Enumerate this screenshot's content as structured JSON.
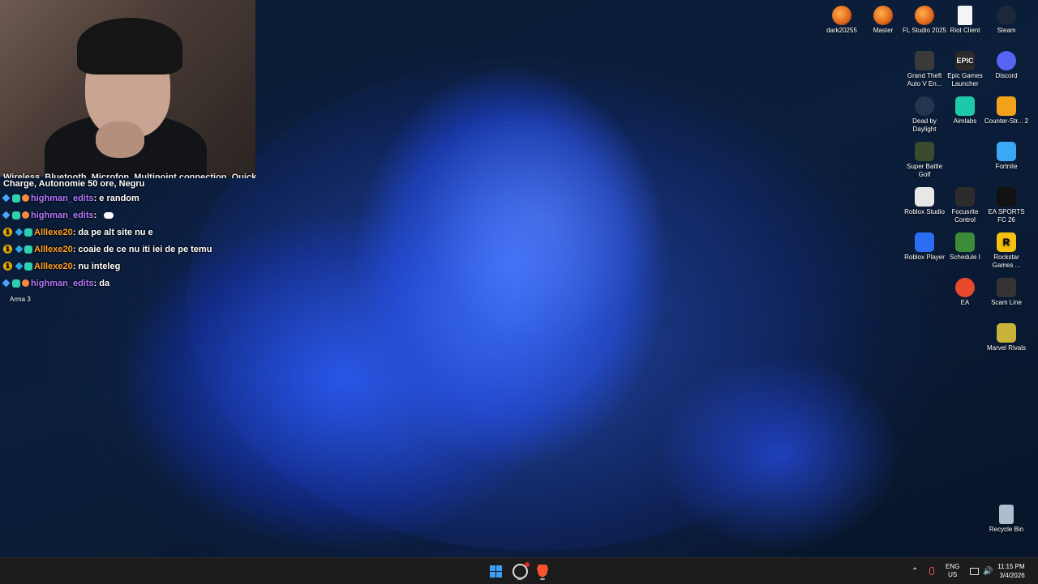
{
  "chat": {
    "header_line_cut": "Wireless, Bluetooth, Microfon, Multipoint connection, Quick",
    "header_line": "Charge, Autonomie 50 ore, Negru",
    "messages": [
      {
        "user": "highman_edits",
        "sep": ":",
        "text": "e random",
        "color": "#b276ff",
        "badges": [
          "sword",
          "sub",
          "bits"
        ]
      },
      {
        "user": "highman_edits",
        "sep": ":",
        "text": "",
        "color": "#b276ff",
        "badges": [
          "sword",
          "sub",
          "bits"
        ],
        "emote": "cloud"
      },
      {
        "user": "Alllexe20",
        "sep": ":",
        "text": "da pe alt site nu e",
        "color": "#ffa126",
        "badges": [
          "one",
          "gem",
          "sub"
        ]
      },
      {
        "user": "Alllexe20",
        "sep": ":",
        "text": "coaie de ce nu iti iei de pe temu",
        "color": "#ffa126",
        "badges": [
          "one",
          "gem",
          "sub"
        ]
      },
      {
        "user": "Alllexe20",
        "sep": ":",
        "text": "nu inteleg",
        "color": "#ffa126",
        "badges": [
          "one",
          "gem",
          "sub"
        ]
      },
      {
        "user": "highman_edits",
        "sep": ":",
        "text": "da",
        "color": "#b276ff",
        "badges": [
          "sword",
          "sub",
          "bits"
        ]
      }
    ],
    "overlay_label": "Arma 3",
    "one_badge": "1"
  },
  "desktop_icons": [
    {
      "label": "dark20255",
      "icon": "fl-studio-icon"
    },
    {
      "label": "Master",
      "icon": "fl-studio-icon"
    },
    {
      "label": "FL Studio 2025",
      "icon": "fl-studio-icon"
    },
    {
      "label": "Riot Client",
      "icon": "document-icon"
    },
    {
      "label": "Steam",
      "icon": "steam-icon"
    },
    {
      "label": "Grand Theft Auto V En...",
      "icon": "gta-icon"
    },
    {
      "label": "Epic Games Launcher",
      "icon": "epic-icon",
      "glyph": "EPIC"
    },
    {
      "label": "Discord",
      "icon": "discord-icon"
    },
    {
      "label": "Dead by Daylight",
      "icon": "dbd-icon"
    },
    {
      "label": "Aimlabs",
      "icon": "aimlabs-icon"
    },
    {
      "label": "Counter-Str... 2",
      "icon": "cs2-icon"
    },
    {
      "label": "Super Battle Golf",
      "icon": "golf-icon"
    },
    {
      "label": "Fortnite",
      "icon": "fortnite-icon"
    },
    {
      "label": "Roblox Studio",
      "icon": "roblox-studio-icon"
    },
    {
      "label": "Focusrite Control",
      "icon": "focusrite-icon"
    },
    {
      "label": "EA SPORTS FC 26",
      "icon": "ea-sports-icon"
    },
    {
      "label": "Roblox Player",
      "icon": "roblox-player-icon"
    },
    {
      "label": "Schedule I",
      "icon": "schedule-icon"
    },
    {
      "label": "Rockstar Games ...",
      "icon": "rockstar-icon",
      "glyph": "R"
    },
    {
      "label": "EA",
      "icon": "ea-icon"
    },
    {
      "label": "Scam Line",
      "icon": "scam-line-icon"
    },
    {
      "label": "Marvel Rivals",
      "icon": "marvel-rivals-icon"
    },
    {
      "label": "Recycle Bin",
      "icon": "recycle-bin-icon"
    }
  ],
  "taskbar": {
    "lang_top": "ENG",
    "lang_bottom": "US",
    "time": "11:15 PM",
    "date": "3/4/2026",
    "accent": "#3aa0ff"
  }
}
